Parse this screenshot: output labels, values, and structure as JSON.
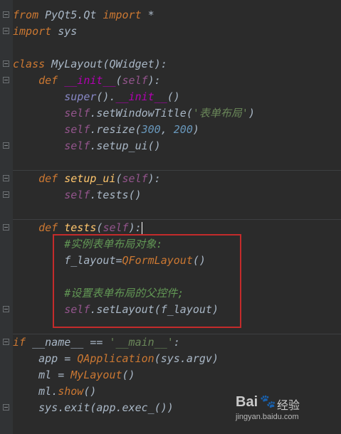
{
  "code": {
    "l1": {
      "kw1": "from",
      "mod": " PyQt5.Qt ",
      "kw2": "import",
      "rest": " *"
    },
    "l2": {
      "kw": "import",
      "rest": " sys"
    },
    "l4": {
      "kw": "class",
      "name": " MyLayout",
      "open": "(",
      "base": "QWidget",
      "close": "):"
    },
    "l5": {
      "indent": "    ",
      "kw": "def",
      "sp": " ",
      "name": "__init__",
      "open": "(",
      "self": "self",
      "close": "):"
    },
    "l6": {
      "indent": "        ",
      "builtin": "super",
      "mid": "().",
      "dunder": "__init__",
      "close": "()"
    },
    "l7": {
      "indent": "        ",
      "self": "self",
      "dot": ".",
      "method": "setWindowTitle",
      "open": "(",
      "str": "'表单布局'",
      "close": ")"
    },
    "l8": {
      "indent": "        ",
      "self": "self",
      "dot": ".",
      "method": "resize",
      "open": "(",
      "n1": "300",
      "comma": ", ",
      "n2": "200",
      "close": ")"
    },
    "l9": {
      "indent": "        ",
      "self": "self",
      "dot": ".",
      "method": "setup_ui",
      "close": "()"
    },
    "l11": {
      "indent": "    ",
      "kw": "def",
      "sp": " ",
      "name": "setup_ui",
      "open": "(",
      "self": "self",
      "close": "):"
    },
    "l12": {
      "indent": "        ",
      "self": "self",
      "dot": ".",
      "method": "tests",
      "close": "()"
    },
    "l14": {
      "indent": "    ",
      "kw": "def",
      "sp": " ",
      "name": "tests",
      "open": "(",
      "self": "self",
      "close": "):"
    },
    "l15": {
      "indent": "        ",
      "comment": "#实例表单布局对象:"
    },
    "l16": {
      "indent": "        ",
      "var": "f_layout",
      "eq": "=",
      "call": "QFormLayout",
      "close": "()"
    },
    "l18": {
      "indent": "        ",
      "comment": "#设置表单布局的父控件;"
    },
    "l19": {
      "indent": "        ",
      "self": "self",
      "dot": ".",
      "method": "setLayout",
      "open": "(",
      "arg": "f_layout",
      "close": ")"
    },
    "l21": {
      "kw": "if",
      "sp": " ",
      "name": "__name__",
      "op": " == ",
      "str": "'__main__'",
      "colon": ":"
    },
    "l22": {
      "indent": "    ",
      "var": "app",
      "op": " = ",
      "call": "QApplication",
      "open": "(",
      "arg": "sys.argv",
      "close": ")"
    },
    "l23": {
      "indent": "    ",
      "var": "ml",
      "op": " = ",
      "call": "MyLayout",
      "close": "()"
    },
    "l24": {
      "indent": "    ",
      "var": "ml",
      "dot": ".",
      "method": "show",
      "close": "()"
    },
    "l25": {
      "indent": "    ",
      "mod": "sys",
      "dot": ".",
      "method": "exit",
      "open": "(",
      "arg": "app",
      "dot2": ".",
      "method2": "exec_",
      "close": "())"
    }
  },
  "watermark": {
    "brand": "Bai",
    "paw": "🐾",
    "cn": "经验",
    "url": "jingyan.baidu.com"
  },
  "colors": {
    "background": "#2b2b2b",
    "keyword": "#cc7832",
    "function": "#ffc66d",
    "self": "#94558d",
    "string": "#6a8759",
    "number": "#6897bb",
    "comment": "#629755",
    "highlight_box": "#c42b2b"
  }
}
